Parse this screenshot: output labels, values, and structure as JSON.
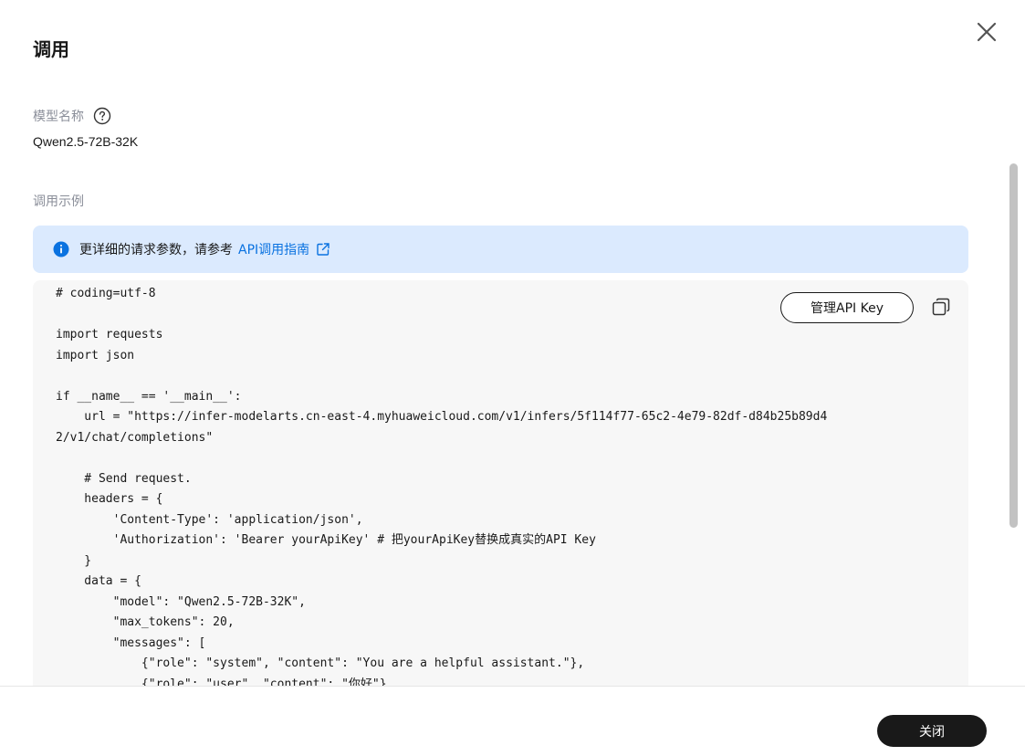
{
  "header": {
    "title": "调用"
  },
  "model": {
    "label": "模型名称",
    "value": "Qwen2.5-72B-32K"
  },
  "example": {
    "label": "调用示例"
  },
  "banner": {
    "text": "更详细的请求参数，请参考",
    "link_text": "API调用指南",
    "info_color": "#0a72e0",
    "bg_color": "#dbeafe"
  },
  "code": {
    "manage_button": "管理API Key",
    "lines": [
      "# coding=utf-8",
      "",
      "import requests",
      "import json",
      "",
      "if __name__ == '__main__':",
      "    url = \"https://infer-modelarts.cn-east-4.myhuaweicloud.com/v1/infers/5f114f77-65c2-4e79-82df-d84b25b89d4",
      "2/v1/chat/completions\"",
      "",
      "    # Send request.",
      "    headers = {",
      "        'Content-Type': 'application/json',",
      "        'Authorization': 'Bearer yourApiKey' # 把yourApiKey替换成真实的API Key",
      "    }",
      "    data = {",
      "        \"model\": \"Qwen2.5-72B-32K\",",
      "        \"max_tokens\": 20,",
      "        \"messages\": [",
      "            {\"role\": \"system\", \"content\": \"You are a helpful assistant.\"},",
      "            {\"role\": \"user\", \"content\": \"你好\"}"
    ]
  },
  "footer": {
    "close_label": "关闭"
  },
  "icons": {
    "close": "close-icon",
    "help": "question-circle-icon",
    "info": "info-circle-icon",
    "external": "external-link-icon",
    "copy": "copy-icon"
  }
}
